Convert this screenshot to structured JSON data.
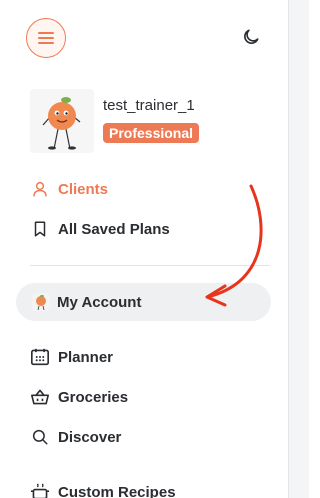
{
  "icons": {
    "menu": "hamburger-menu-icon",
    "theme": "moon-icon",
    "clients": "user-icon",
    "saved_plans": "bookmark-icon",
    "planner": "calendar-icon",
    "groceries": "basket-icon",
    "discover": "search-icon",
    "custom_recipes": "cooking-pot-icon"
  },
  "colors": {
    "accent": "#ee7a55",
    "annotation_arrow": "#e8341c",
    "active_pill": "#eef0f2"
  },
  "profile": {
    "username": "test_trainer_1",
    "plan_badge": "Professional"
  },
  "nav": {
    "clients": "Clients",
    "saved_plans": "All Saved Plans",
    "my_account": "My Account",
    "planner": "Planner",
    "groceries": "Groceries",
    "discover": "Discover",
    "custom_recipes": "Custom Recipes"
  }
}
